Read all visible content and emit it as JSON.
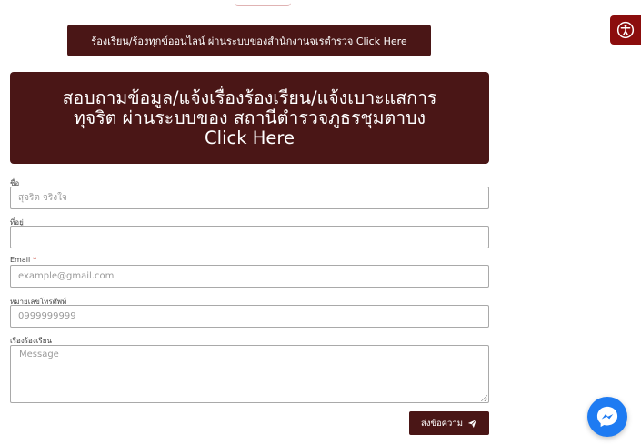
{
  "header": {
    "report_button_label": "ร้องเรียน/ร้องทุกข์ออนไลน์ ผ่านระบบของสำนักงานจเรตำรวจ Click Here",
    "banner_line1": "สอบถามข้อมูล/แจ้งเรื่องร้องเรียน/แจ้งเบาะแสการ",
    "banner_line2": "ทุจริต ผ่านระบบของ สถานีตำรวจภูธรชุมตาบง",
    "banner_line3": "Click Here"
  },
  "form": {
    "name": {
      "label": "ชื่อ",
      "placeholder": "สุจริต จริงใจ"
    },
    "address": {
      "label": "ที่อยู่",
      "placeholder": ""
    },
    "email": {
      "label": "Email",
      "required_mark": "*",
      "placeholder": "example@gmail.com"
    },
    "phone": {
      "label": "หมายเลขโทรศัพท์",
      "placeholder": "0999999999"
    },
    "message": {
      "label": "เรื่องร้องเรียน",
      "placeholder": "Message"
    },
    "submit_label": "ส่งข้อความ"
  },
  "colors": {
    "brand": "#4a1616",
    "accessibility": "#8b0d0d",
    "messenger": "#1e7bf2"
  },
  "icons": {
    "submit": "paper-plane-icon",
    "accessibility": "accessibility-icon",
    "messenger": "messenger-icon"
  }
}
